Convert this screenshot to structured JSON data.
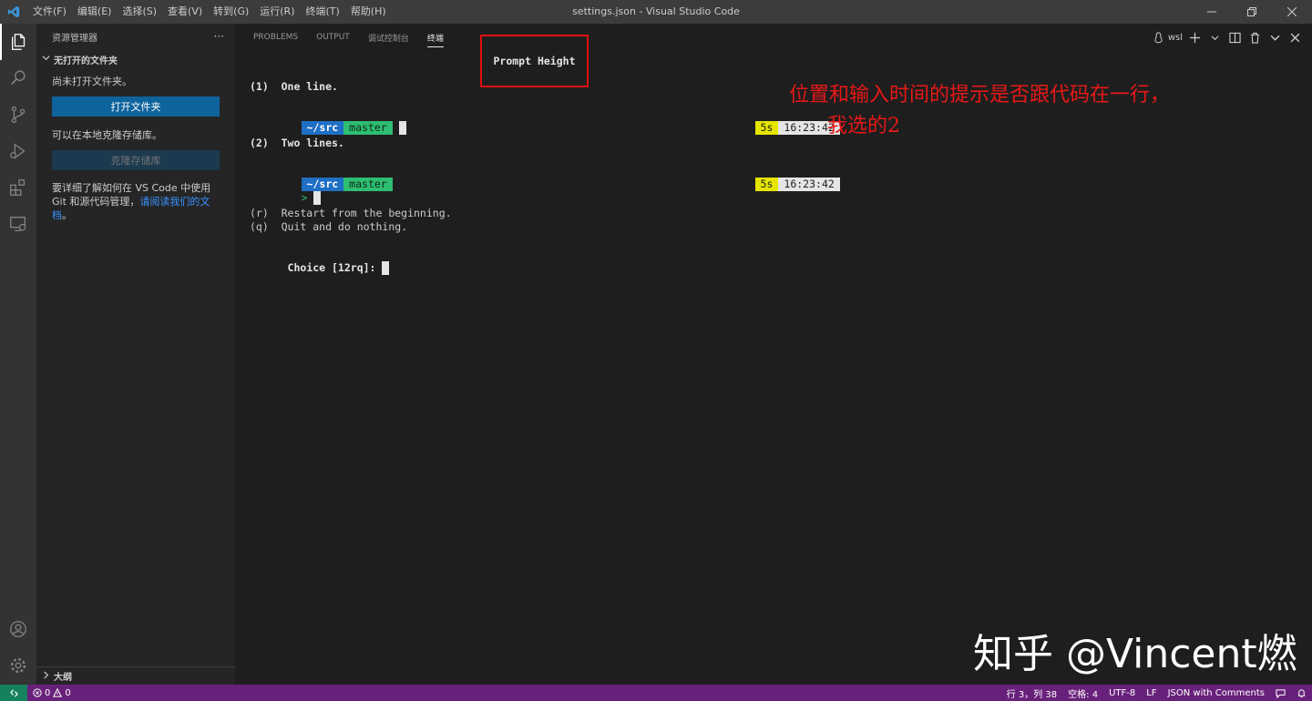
{
  "window": {
    "title": "settings.json - Visual Studio Code",
    "menu": [
      "文件(F)",
      "编辑(E)",
      "选择(S)",
      "查看(V)",
      "转到(G)",
      "运行(R)",
      "终端(T)",
      "帮助(H)"
    ]
  },
  "sidebar": {
    "header": "资源管理器",
    "more": "···",
    "section": "无打开的文件夹",
    "no_folder_text": "尚未打开文件夹。",
    "open_folder_button": "打开文件夹",
    "clone_text": "可以在本地克隆存储库。",
    "clone_button": "克隆存储库",
    "learn_text": "要详细了解如何在 VS Code 中使用 Git 和源代码管理，",
    "learn_link": "请阅读我们的文档",
    "learn_end": "。",
    "outline": "大纲"
  },
  "panel": {
    "tabs": [
      "PROBLEMS",
      "OUTPUT",
      "调试控制台",
      "终端"
    ],
    "active_tab": "终端",
    "terminal_name": "wsl"
  },
  "terminal": {
    "heading": "Prompt Height",
    "option1": "(1)  One line.",
    "option2": "(2)  Two lines.",
    "dir": "~/src",
    "branch": "master",
    "duration": "5s",
    "time": "16:23:42",
    "prompt_char": ">",
    "restart": "(r)  Restart from the beginning.",
    "quit": "(q)  Quit and do nothing.",
    "choice": "Choice [12rq]:"
  },
  "annotation": {
    "line1": "位置和输入时间的提示是否跟代码在一行，",
    "line2": "我选的2"
  },
  "watermark": "知乎 @Vincent燃",
  "statusbar": {
    "errors": "0",
    "warnings": "0",
    "position": "行 3，列 38",
    "spaces": "空格: 4",
    "encoding": "UTF-8",
    "eol": "LF",
    "language": "JSON with Comments"
  },
  "colors": {
    "statusbar": "#68217a",
    "remote": "#16825d",
    "button": "#0e639c",
    "segment_dir": "#1f6fc5",
    "segment_branch": "#2ebd72",
    "segment_duration": "#e5e500",
    "annotation": "#e81818"
  }
}
